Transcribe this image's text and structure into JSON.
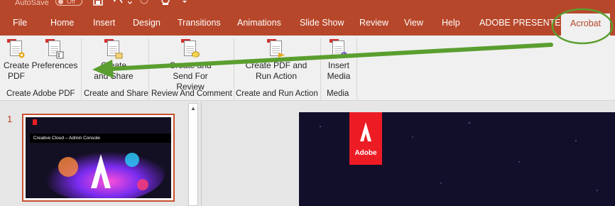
{
  "titlebar": {
    "autosave_label": "AutoSave",
    "autosave_state": "Off",
    "icons": [
      "save-icon",
      "undo-icon",
      "redo-icon",
      "present-icon",
      "customize-icon"
    ]
  },
  "tabs": [
    "File",
    "Home",
    "Insert",
    "Design",
    "Transitions",
    "Animations",
    "Slide Show",
    "Review",
    "View",
    "Help",
    "ADOBE PRESENTER",
    "Acrobat"
  ],
  "active_tab": "Acrobat",
  "ribbon": {
    "groups": [
      {
        "label": "Create Adobe PDF",
        "buttons": [
          {
            "line1": "Create",
            "line2": "PDF"
          },
          {
            "line1": "Preferences",
            "line2": ""
          }
        ]
      },
      {
        "label": "Create and Share",
        "buttons": [
          {
            "line1": "Create",
            "line2": "and Share"
          }
        ]
      },
      {
        "label": "Review And Comment",
        "buttons": [
          {
            "line1": "Create and",
            "line2": "Send For Review"
          }
        ]
      },
      {
        "label": "Create and Run Action",
        "buttons": [
          {
            "line1": "Create PDF and",
            "line2": "Run Action"
          }
        ]
      },
      {
        "label": "Media",
        "buttons": [
          {
            "line1": "Insert",
            "line2": "Media"
          }
        ]
      }
    ]
  },
  "slides": {
    "current_number": "1",
    "thumbnail_title": "Creative Cloud – Admin Console"
  },
  "slide": {
    "logo_text": "Adobe"
  },
  "colors": {
    "ribbon_accent": "#b7472a",
    "annotation_arrow": "#5a9e2f",
    "adobe_red": "#ed1c24"
  }
}
